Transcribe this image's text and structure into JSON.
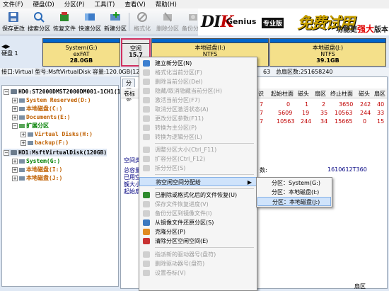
{
  "menu": [
    "文件(F)",
    "硬盘(D)",
    "分区(P)",
    "工具(T)",
    "查看(V)",
    "帮助(H)"
  ],
  "toolbar": [
    {
      "label": "保存更改",
      "icon": "save-icon",
      "enabled": true
    },
    {
      "label": "搜索分区",
      "icon": "search-partition-icon",
      "enabled": true
    },
    {
      "label": "恢复文件",
      "icon": "recover-file-icon",
      "enabled": true
    },
    {
      "label": "快速分区",
      "icon": "quick-partition-icon",
      "enabled": true
    },
    {
      "label": "新建分区",
      "icon": "new-partition-icon",
      "enabled": true
    },
    {
      "label": "格式化",
      "icon": "format-icon",
      "enabled": false
    },
    {
      "label": "删除分区",
      "icon": "delete-partition-icon",
      "enabled": false
    },
    {
      "label": "备份分区",
      "icon": "backup-partition-icon",
      "enabled": false
    }
  ],
  "banner": {
    "logo_main": "DI",
    "logo_k": "K",
    "logo_text": "Genius",
    "edition": "专业版",
    "promo": "免费试用",
    "slogan_prefix": "功能更",
    "slogan_strong": "强大",
    "slogan_suffix": "版本"
  },
  "diskmap": {
    "disk_label": [
      "硬盘 1"
    ],
    "partitions": [
      {
        "name": "System(G:)",
        "fs": "exFAT",
        "size": "28.0GB"
      },
      {
        "name": "空闲",
        "fs": "",
        "size": "15.7"
      },
      {
        "name": "本地磁盘(I:)",
        "fs": "NTFS",
        "size": ""
      },
      {
        "name": "本地磁盘(J:)",
        "fs": "NTFS",
        "size": "39.1GB"
      }
    ]
  },
  "infostrip": {
    "left": "接口:Virtual  型号:MsftVirtualDisk  容量:120.0GB(122...",
    "mid": "63",
    "right": "总扇区数:251658240"
  },
  "tree": {
    "disk0": "HD0:ST2000DMST2000DM001-1CH1(186",
    "disk0_parts": [
      "System Reserved(D:)",
      "本地磁盘(C:)",
      "Documents(E:)",
      "扩展分区",
      "Virtual Disks(H:)",
      "backup(F:)"
    ],
    "disk1": "HD1:MsftVirtualDisk(120GB)",
    "disk1_parts": [
      "System(G:)",
      "本地磁盘(I:)",
      "本地磁盘(J:)"
    ]
  },
  "right": {
    "tabs": [
      "分区参"
    ],
    "headers": [
      "卷标",
      "识",
      "起始柱面",
      "磁头",
      "扇区",
      "终止柱面",
      "磁头",
      "扇区"
    ],
    "rows": [
      {
        "id": "7",
        "start_cyl": "0",
        "head1": "1",
        "sec1": "2",
        "end_cyl": "3650",
        "head2": "242",
        "sec2": "40"
      },
      {
        "id": "7",
        "start_cyl": "5609",
        "head1": "19",
        "sec1": "35",
        "end_cyl": "10563",
        "head2": "244",
        "sec2": "33"
      },
      {
        "id": "7",
        "start_cyl": "10563",
        "head1": "244",
        "sec1": "34",
        "end_cyl": "15665",
        "head2": "0",
        "sec2": "15"
      }
    ],
    "lower": [
      "空间类",
      "总容量",
      "已用空",
      "簇大小",
      "起始扇"
    ],
    "lower_right_label": "数:",
    "lower_right_value": "1610612T360",
    "bottom_right": "扇区"
  },
  "context_menu": [
    {
      "label": "建立新分区(N)",
      "enabled": true
    },
    {
      "label": "格式化当前分区(F)",
      "enabled": false
    },
    {
      "label": "删除当前分区(Del)",
      "enabled": false
    },
    {
      "label": "隐藏/取消隐藏当前分区(H)",
      "enabled": false
    },
    {
      "label": "激活当前分区(F7)",
      "enabled": false
    },
    {
      "label": "取消分区激活状态(A)",
      "enabled": false
    },
    {
      "label": "更改分区参数(F11)",
      "enabled": false
    },
    {
      "label": "转换为主分区(P)",
      "enabled": false
    },
    {
      "label": "转换为逻辑分区(L)",
      "enabled": false
    },
    {
      "label": "调整分区大小(Ctrl_F11)",
      "enabled": false
    },
    {
      "label": "扩容分区(Ctrl_F12)",
      "enabled": false
    },
    {
      "label": "拆分分区(S)",
      "enabled": false
    },
    {
      "label": "将空闲空间分配给",
      "enabled": true,
      "highlighted": true,
      "submenu": true
    },
    {
      "label": "已删除或格式化后的文件恢复(U)",
      "enabled": true
    },
    {
      "label": "保存文件恢复进度(V)",
      "enabled": false
    },
    {
      "label": "备份分区到镜像文件(I)",
      "enabled": false
    },
    {
      "label": "从镜像文件还原分区(S)",
      "enabled": true
    },
    {
      "label": "克隆分区(P)",
      "enabled": true
    },
    {
      "label": "清除分区空闲空间(E)",
      "enabled": true
    },
    {
      "label": "指派新的驱动器号(盘符)",
      "enabled": false
    },
    {
      "label": "删除驱动器号(盘符)",
      "enabled": false
    },
    {
      "label": "设置卷标(V)",
      "enabled": false
    }
  ],
  "submenu": [
    "分区：System(G:)",
    "分区：本地磁盘(I:)",
    "分区：本地磁盘(J:)"
  ]
}
